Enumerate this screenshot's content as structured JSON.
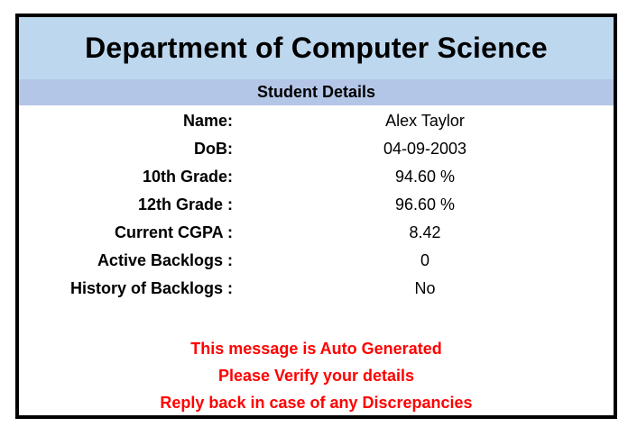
{
  "header": {
    "title": "Department of Computer Science",
    "section": "Student Details"
  },
  "details": [
    {
      "label": "Name:",
      "value": "Alex Taylor"
    },
    {
      "label": "DoB:",
      "value": "04-09-2003"
    },
    {
      "label": "10th Grade:",
      "value": "94.60 %"
    },
    {
      "label": "12th Grade :",
      "value": "96.60 %"
    },
    {
      "label": "Current CGPA :",
      "value": "8.42"
    },
    {
      "label": "Active Backlogs :",
      "value": "0"
    },
    {
      "label": "History of Backlogs :",
      "value": "No"
    }
  ],
  "messages": [
    "This message is Auto Generated",
    "Please Verify your details",
    "Reply back in case of any Discrepancies"
  ],
  "colors": {
    "title_bg": "#bdd7ee",
    "section_bg": "#b4c6e7",
    "message_text": "#ff0000",
    "border": "#000000"
  }
}
